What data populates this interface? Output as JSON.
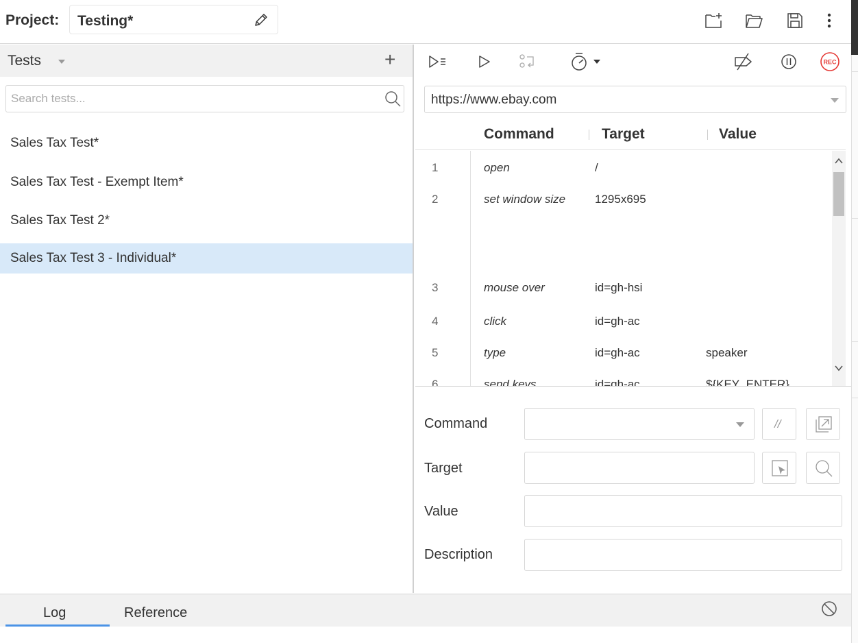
{
  "header": {
    "project_label": "Project:",
    "project_name": "Testing*"
  },
  "tests_panel": {
    "title": "Tests",
    "add_label": "+",
    "search_placeholder": "Search tests...",
    "items": [
      {
        "label": "Sales Tax Test*"
      },
      {
        "label": "Sales Tax Test - Exempt Item*"
      },
      {
        "label": "Sales Tax Test 2*"
      },
      {
        "label": "Sales Tax Test 3 - Individual*",
        "selected": true
      }
    ]
  },
  "editor": {
    "base_url": "https://www.ebay.com",
    "columns": [
      "Command",
      "Target",
      "Value"
    ],
    "rows": [
      {
        "n": "1",
        "command": "open",
        "target": "/",
        "value": ""
      },
      {
        "n": "2",
        "command": "set window size",
        "target": "1295x695",
        "value": ""
      },
      {
        "n": "3",
        "command": "mouse over",
        "target": "id=gh-hsi",
        "value": ""
      },
      {
        "n": "4",
        "command": "click",
        "target": "id=gh-ac",
        "value": ""
      },
      {
        "n": "5",
        "command": "type",
        "target": "id=gh-ac",
        "value": "speaker"
      },
      {
        "n": "6",
        "command": "send keys",
        "target": "id=gh-ac",
        "value": "${KEY_ENTER}"
      }
    ],
    "form": {
      "command_label": "Command",
      "target_label": "Target",
      "value_label": "Value",
      "description_label": "Description",
      "comment_button": "//"
    }
  },
  "bottom": {
    "tabs": [
      "Log",
      "Reference"
    ],
    "active_tab": "Log"
  },
  "colors": {
    "selected_row": "#d8e9f9",
    "rec_red": "#e53935",
    "tab_underline": "#4b93e6"
  },
  "icons": [
    "pencil-icon",
    "new-project-icon",
    "open-folder-icon",
    "save-icon",
    "more-icon",
    "run-all-icon",
    "run-icon",
    "step-icon",
    "speed-icon",
    "breakpoints-disable-icon",
    "pause-icon",
    "record-icon",
    "search-icon",
    "select-target-icon",
    "find-target-icon",
    "open-in-new-icon",
    "clear-log-icon"
  ]
}
